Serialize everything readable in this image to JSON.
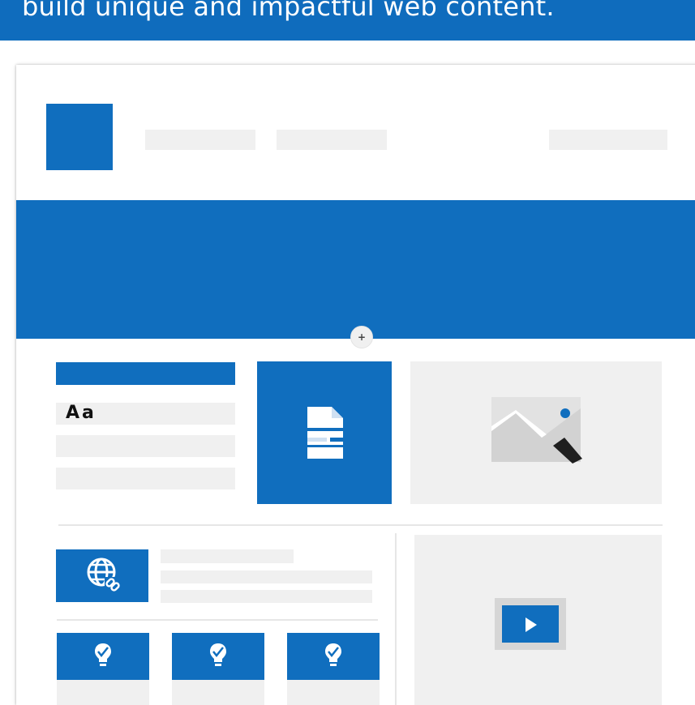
{
  "banner": {
    "text": "build unique and impactful web content.",
    "color": "#0f6cbd"
  },
  "mockup": {
    "accent_color": "#106ebe",
    "placeholder_color": "#f0f0f0",
    "add_button_label": "+",
    "text_sample": "Aa",
    "icons": {
      "document": "document-icon",
      "image": "image-icon",
      "globe_link": "globe-link-icon",
      "quick_links": [
        "lightbulb-check-icon",
        "lightbulb-check-icon",
        "lightbulb-check-icon"
      ],
      "video": "video-play-icon"
    }
  }
}
